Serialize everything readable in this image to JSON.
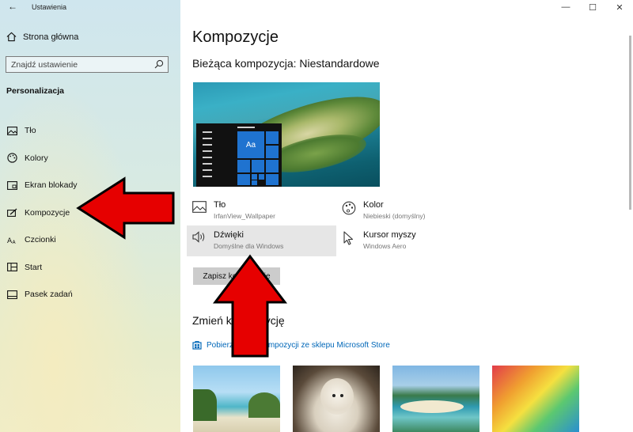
{
  "window": {
    "title": "Ustawienia",
    "controls": [
      "minimize",
      "maximize",
      "close"
    ]
  },
  "sidebar": {
    "home_label": "Strona główna",
    "search_placeholder": "Znajdź ustawienie",
    "section_title": "Personalizacja",
    "items": [
      {
        "label": "Tło",
        "icon": "image-icon"
      },
      {
        "label": "Kolory",
        "icon": "palette-icon"
      },
      {
        "label": "Ekran blokady",
        "icon": "lock-screen-icon"
      },
      {
        "label": "Kompozycje",
        "icon": "theme-brush-icon"
      },
      {
        "label": "Czcionki",
        "icon": "font-icon"
      },
      {
        "label": "Start",
        "icon": "start-grid-icon"
      },
      {
        "label": "Pasek zadań",
        "icon": "taskbar-icon"
      }
    ]
  },
  "main": {
    "title": "Kompozycje",
    "current_theme": "Bieżąca kompozycja: Niestandardowe",
    "preview_tile_text": "Aa",
    "settings": [
      {
        "label": "Tło",
        "value": "IrfanView_Wallpaper",
        "icon": "image-icon"
      },
      {
        "label": "Kolor",
        "value": "Niebieski (domyślny)",
        "icon": "palette-icon"
      },
      {
        "label": "Dźwięki",
        "value": "Domyślne dla Windows",
        "icon": "speaker-icon"
      },
      {
        "label": "Kursor myszy",
        "value": "Windows Aero",
        "icon": "cursor-icon"
      }
    ],
    "save_button": "Zapisz kompozycje",
    "change_title": "Zmień kompozycję",
    "store_link": "Pobierz więcej kompozycji ze sklepu Microsoft Store",
    "colors": {
      "accent": "#0067b8",
      "tile": "#1f73d0",
      "arrow": "#e60000"
    }
  }
}
